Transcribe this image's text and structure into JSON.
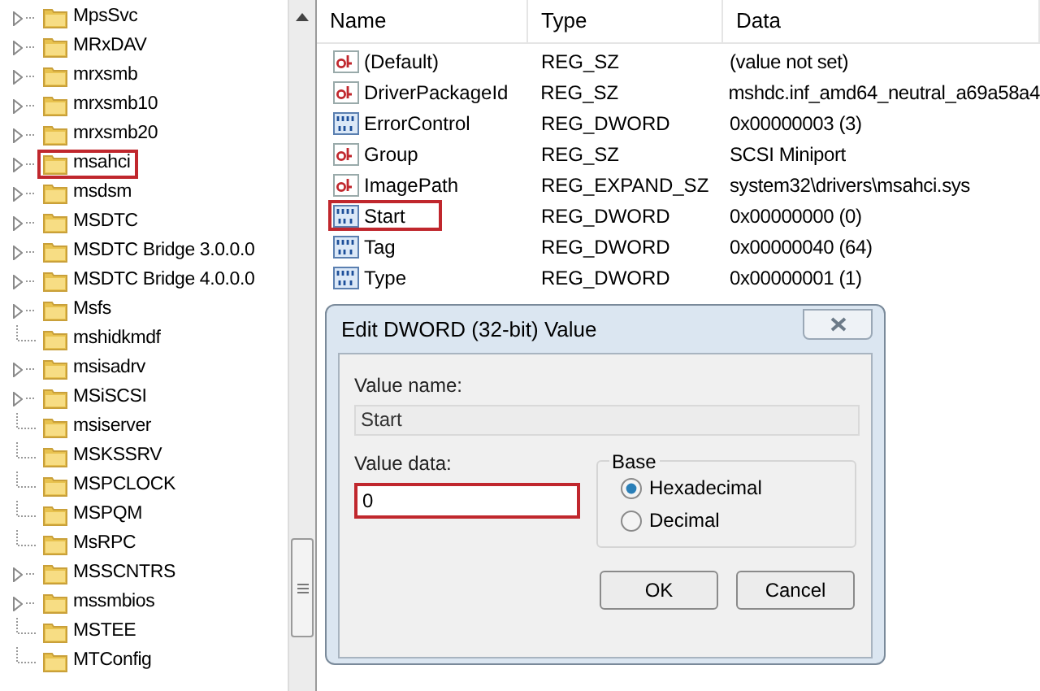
{
  "tree": {
    "items": [
      {
        "label": "MpsSvc",
        "has_children": true,
        "highlighted": false
      },
      {
        "label": "MRxDAV",
        "has_children": true,
        "highlighted": false
      },
      {
        "label": "mrxsmb",
        "has_children": true,
        "highlighted": false
      },
      {
        "label": "mrxsmb10",
        "has_children": true,
        "highlighted": false
      },
      {
        "label": "mrxsmb20",
        "has_children": true,
        "highlighted": false
      },
      {
        "label": "msahci",
        "has_children": true,
        "highlighted": true
      },
      {
        "label": "msdsm",
        "has_children": true,
        "highlighted": false
      },
      {
        "label": "MSDTC",
        "has_children": true,
        "highlighted": false
      },
      {
        "label": "MSDTC Bridge 3.0.0.0",
        "has_children": true,
        "highlighted": false
      },
      {
        "label": "MSDTC Bridge 4.0.0.0",
        "has_children": true,
        "highlighted": false
      },
      {
        "label": "Msfs",
        "has_children": true,
        "highlighted": false
      },
      {
        "label": "mshidkmdf",
        "has_children": false,
        "highlighted": false
      },
      {
        "label": "msisadrv",
        "has_children": true,
        "highlighted": false
      },
      {
        "label": "MSiSCSI",
        "has_children": true,
        "highlighted": false
      },
      {
        "label": "msiserver",
        "has_children": false,
        "highlighted": false
      },
      {
        "label": "MSKSSRV",
        "has_children": false,
        "highlighted": false
      },
      {
        "label": "MSPCLOCK",
        "has_children": false,
        "highlighted": false
      },
      {
        "label": "MSPQM",
        "has_children": false,
        "highlighted": false
      },
      {
        "label": "MsRPC",
        "has_children": false,
        "highlighted": false
      },
      {
        "label": "MSSCNTRS",
        "has_children": true,
        "highlighted": false
      },
      {
        "label": "mssmbios",
        "has_children": true,
        "highlighted": false
      },
      {
        "label": "MSTEE",
        "has_children": false,
        "highlighted": false
      },
      {
        "label": "MTConfig",
        "has_children": false,
        "highlighted": false
      }
    ]
  },
  "values": {
    "columns": [
      "Name",
      "Type",
      "Data"
    ],
    "rows": [
      {
        "kind": "string",
        "name": "(Default)",
        "type": "REG_SZ",
        "data": "(value not set)",
        "highlighted": false
      },
      {
        "kind": "string",
        "name": "DriverPackageId",
        "type": "REG_SZ",
        "data": "mshdc.inf_amd64_neutral_a69a58a4",
        "highlighted": false
      },
      {
        "kind": "dword",
        "name": "ErrorControl",
        "type": "REG_DWORD",
        "data": "0x00000003 (3)",
        "highlighted": false
      },
      {
        "kind": "string",
        "name": "Group",
        "type": "REG_SZ",
        "data": "SCSI Miniport",
        "highlighted": false
      },
      {
        "kind": "string",
        "name": "ImagePath",
        "type": "REG_EXPAND_SZ",
        "data": "system32\\drivers\\msahci.sys",
        "highlighted": false
      },
      {
        "kind": "dword",
        "name": "Start",
        "type": "REG_DWORD",
        "data": "0x00000000 (0)",
        "highlighted": true
      },
      {
        "kind": "dword",
        "name": "Tag",
        "type": "REG_DWORD",
        "data": "0x00000040 (64)",
        "highlighted": false
      },
      {
        "kind": "dword",
        "name": "Type",
        "type": "REG_DWORD",
        "data": "0x00000001 (1)",
        "highlighted": false
      }
    ]
  },
  "dialog": {
    "title": "Edit DWORD (32-bit) Value",
    "value_name_label": "Value name:",
    "value_name": "Start",
    "value_data_label": "Value data:",
    "value_data": "0",
    "value_data_highlighted": true,
    "base_label": "Base",
    "base_options": [
      {
        "label": "Hexadecimal",
        "selected": true
      },
      {
        "label": "Decimal",
        "selected": false
      }
    ],
    "buttons": [
      "OK",
      "Cancel"
    ]
  }
}
